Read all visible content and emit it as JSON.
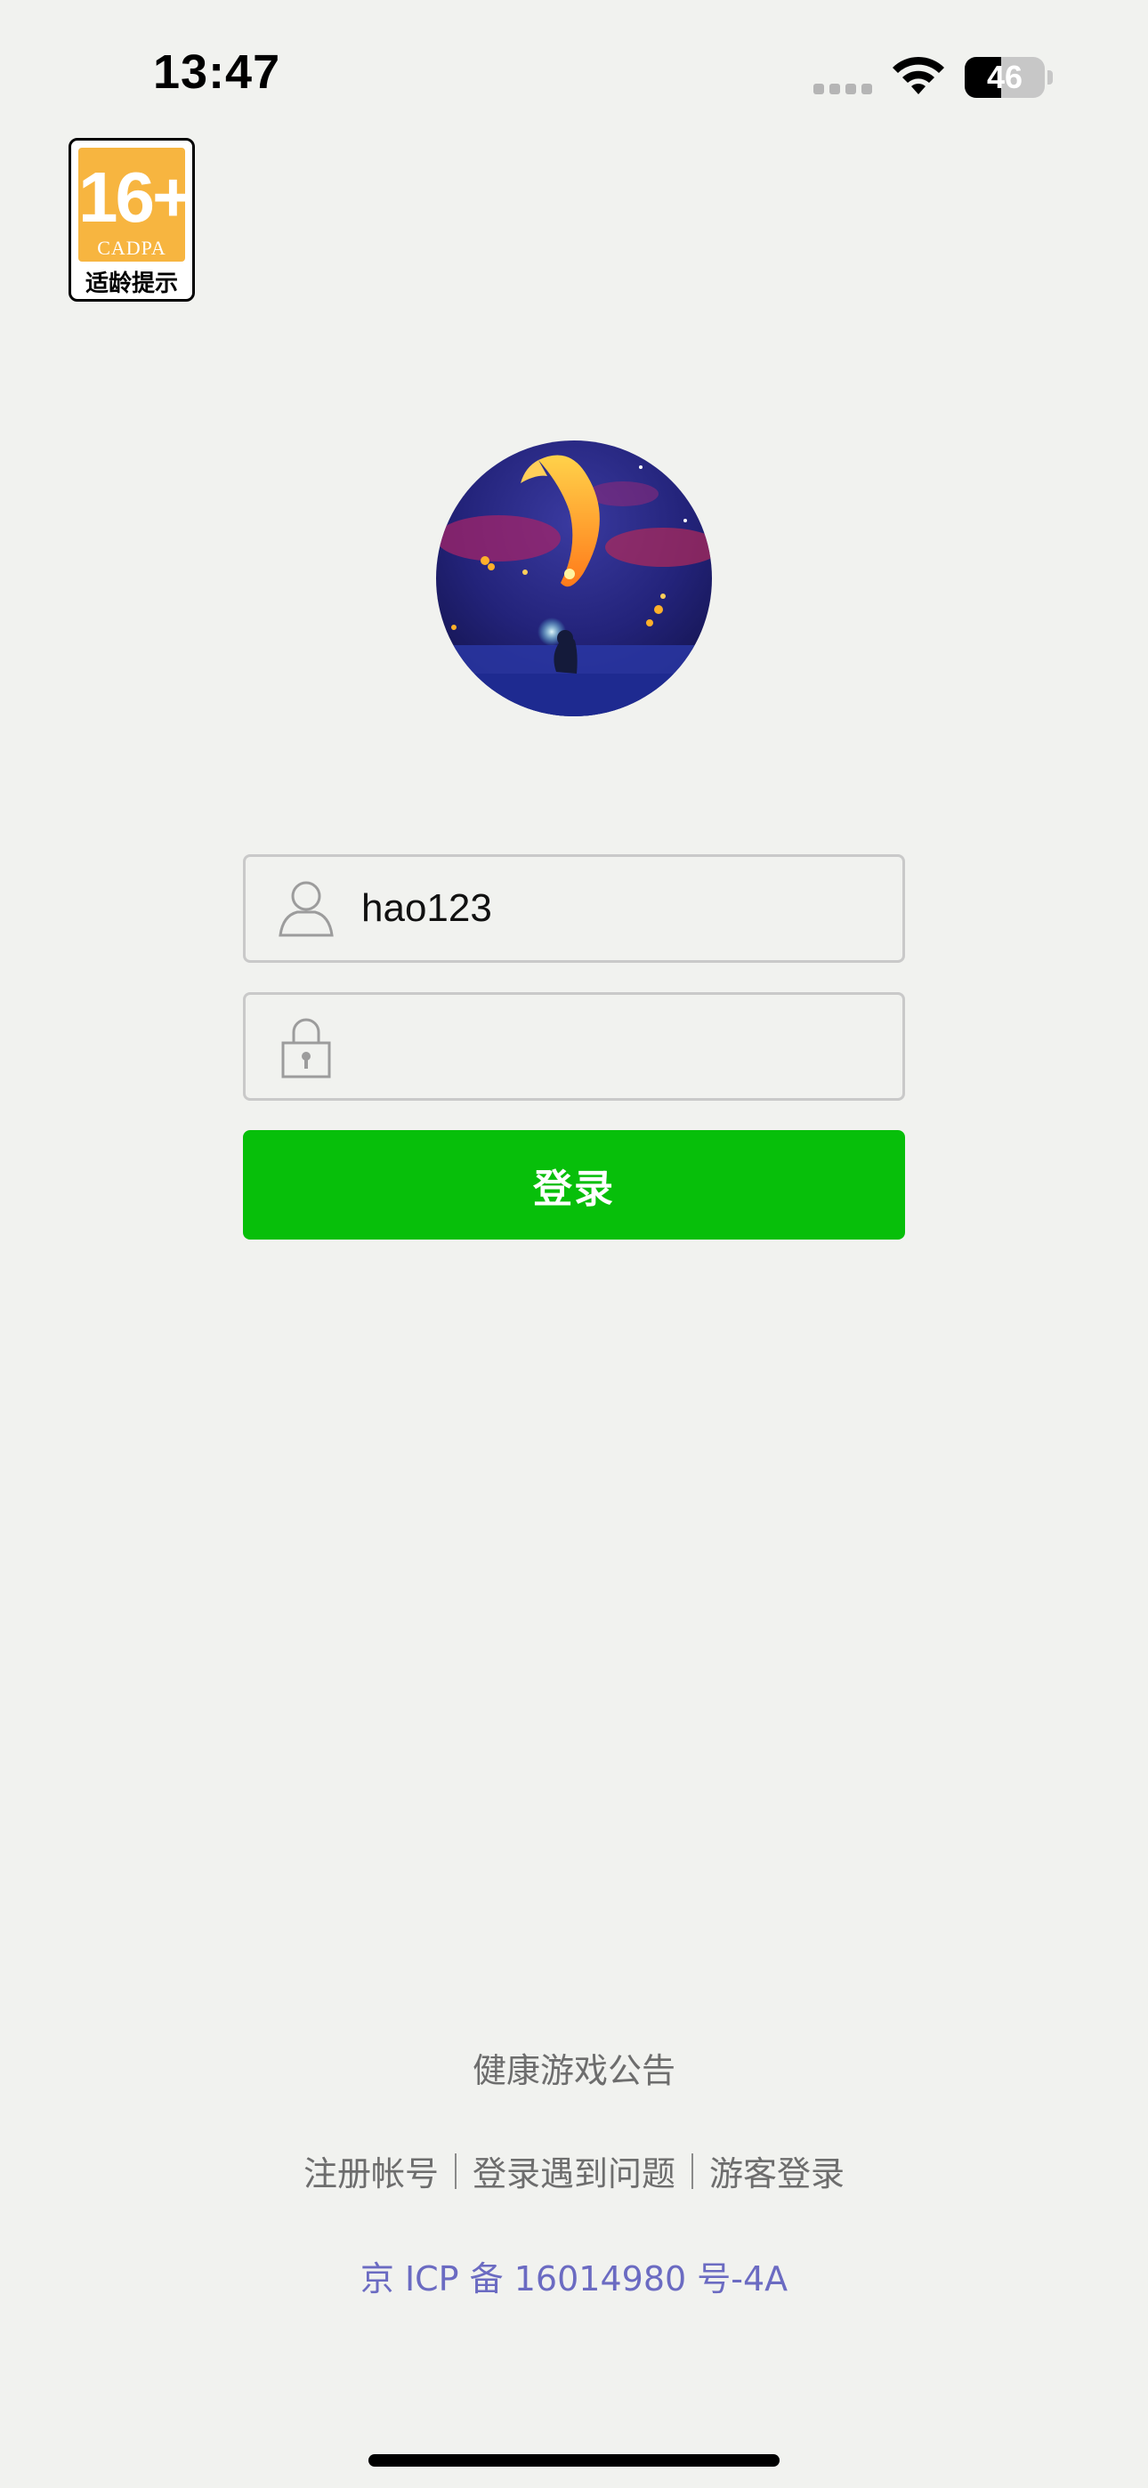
{
  "status_bar": {
    "time": "13:47",
    "battery_level": "46",
    "battery_fraction": 0.46
  },
  "age_badge": {
    "rating": "16+",
    "org": "CADPA",
    "caption": "适龄提示"
  },
  "login_form": {
    "username_value": "hao123",
    "password_value": "",
    "login_label": "登录"
  },
  "footer": {
    "notice_link": "健康游戏公告",
    "links": [
      "注册帐号",
      "登录遇到问题",
      "游客登录"
    ],
    "icp": "京 ICP 备 16014980 号-4A"
  },
  "colors": {
    "background": "#f1f2ef",
    "primary_button": "#07bf0a",
    "icp_text": "#6b6bc2",
    "badge_orange": "#f7b540"
  },
  "icons": {
    "user_field": "user-icon",
    "password_field": "lock-icon",
    "wifi": "wifi-icon"
  }
}
